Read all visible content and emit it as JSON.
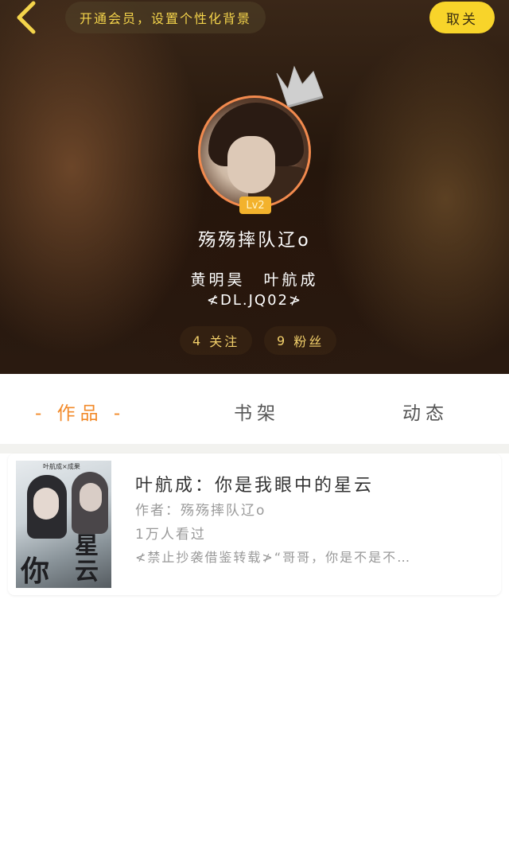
{
  "header": {
    "vip_banner": "开通会员，设置个性化背景",
    "cancel_label": "取关"
  },
  "profile": {
    "level": "Lv2",
    "username": "殇殇摔队辽o",
    "bio_line1": "黄明昊　叶航成",
    "bio_line2": "≮DL.JQ02≯",
    "following": {
      "count": "4",
      "label": "关注"
    },
    "fans": {
      "count": "9",
      "label": "粉丝"
    }
  },
  "tabs": [
    {
      "label": "- 作品 -",
      "active": true
    },
    {
      "label": "书架",
      "active": false
    },
    {
      "label": "动态",
      "active": false
    }
  ],
  "book": {
    "title": "叶航成：你是我眼中的星云",
    "author": "作者：殇殇摔队辽o",
    "reads": "1万人看过",
    "description": "≮禁止抄袭借鉴转载≯“哥哥，你是不是不…",
    "cover": {
      "top_text": "叶航成×成果",
      "big_char": "你",
      "side_chars": "星云"
    }
  },
  "colors": {
    "accent_orange": "#f28a2a",
    "cancel_yellow": "#f8d42a",
    "vip_text": "#f4d44b",
    "level_badge": "#f3b22c"
  },
  "icons": {
    "back": "chevron-left-icon",
    "crown": "crown-icon"
  }
}
